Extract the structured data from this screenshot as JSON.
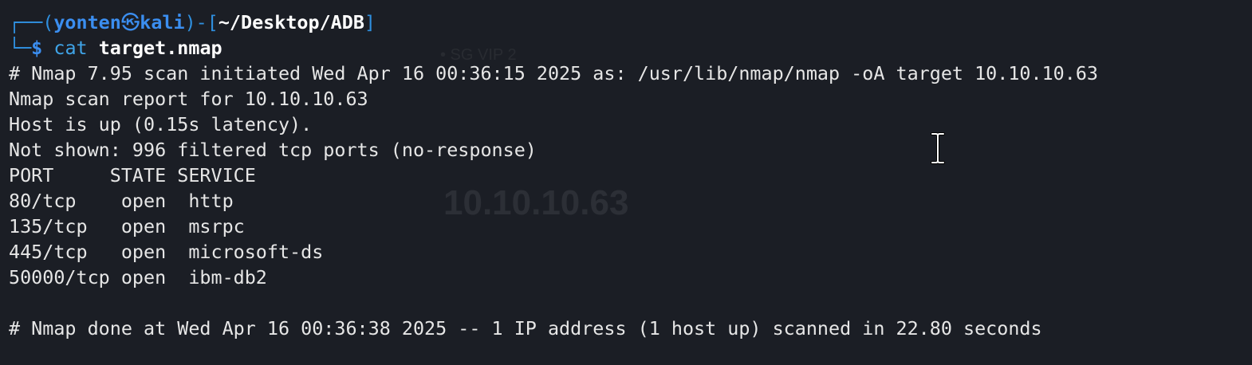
{
  "prompt": {
    "frame_open": "┌──(",
    "user": "yonten",
    "at_symbol": "㉿",
    "host": "kali",
    "frame_mid": ")-[",
    "path": "~/Desktop/ADB",
    "frame_close": "]",
    "frame_bottom": "└─",
    "dollar": "$",
    "command": "cat",
    "argument": "target.nmap"
  },
  "output": [
    "# Nmap 7.95 scan initiated Wed Apr 16 00:36:15 2025 as: /usr/lib/nmap/nmap -oA target 10.10.10.63",
    "Nmap scan report for 10.10.10.63",
    "Host is up (0.15s latency).",
    "Not shown: 996 filtered tcp ports (no-response)",
    "PORT     STATE SERVICE",
    "80/tcp    open  http",
    "135/tcp   open  msrpc",
    "445/tcp   open  microsoft-ds",
    "50000/tcp open  ibm-db2",
    "",
    "# Nmap done at Wed Apr 16 00:36:38 2025 -- 1 IP address (1 host up) scanned in 22.80 seconds"
  ],
  "ghost": {
    "vip": "• SG VIP 2",
    "ip": "10.10.10.63"
  },
  "colors": {
    "background": "#1b1e25",
    "prompt_blue": "#3b8ef0",
    "text": "#e6e6e6"
  },
  "icons": {
    "cursor": "text-cursor-ibeam-icon"
  }
}
